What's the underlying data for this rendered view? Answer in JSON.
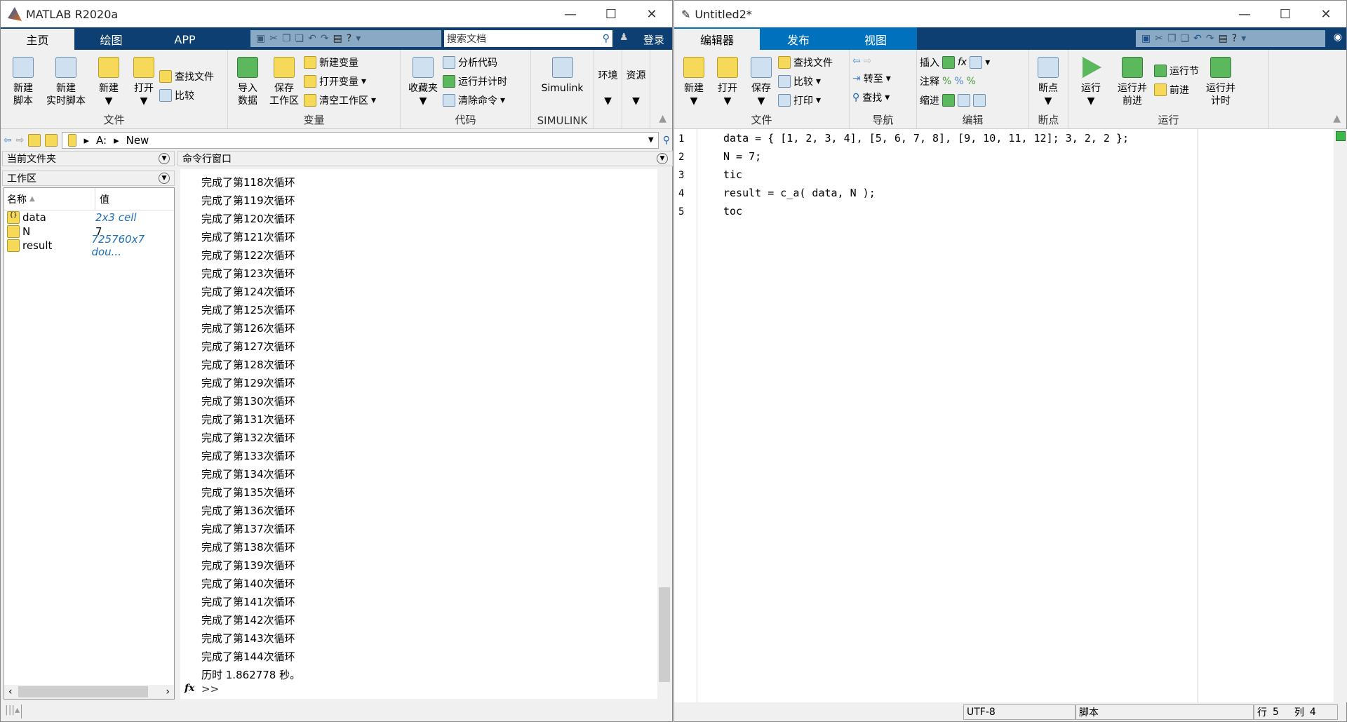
{
  "left": {
    "title": "MATLAB R2020a",
    "tabs": [
      "主页",
      "绘图",
      "APP"
    ],
    "search_placeholder": "搜索文档",
    "login": "登录",
    "groups": {
      "file": {
        "label": "文件",
        "new_script": [
          "新建",
          "脚本"
        ],
        "new_live": [
          "新建",
          "实时脚本"
        ],
        "new": "新建",
        "open": "打开",
        "find_files": "查找文件",
        "compare": "比较"
      },
      "variable": {
        "label": "变量",
        "import": [
          "导入",
          "数据"
        ],
        "save_ws": [
          "保存",
          "工作区"
        ],
        "new_var": "新建变量",
        "open_var": "打开变量",
        "clear_ws": "清空工作区"
      },
      "code": {
        "label": "代码",
        "favorites": "收藏夹",
        "analyze": "分析代码",
        "run_time": "运行并计时",
        "clear_cmd": "清除命令"
      },
      "simulink": {
        "label": "SIMULINK",
        "simulink": "Simulink"
      },
      "env": "环境",
      "resources": "资源"
    },
    "path": [
      "A:",
      "New"
    ],
    "current_folder": "当前文件夹",
    "workspace": {
      "title": "工作区",
      "col_name": "名称",
      "col_value": "值",
      "rows": [
        {
          "name": "data",
          "value": "2x3 cell"
        },
        {
          "name": "N",
          "value": "7"
        },
        {
          "name": "result",
          "value": "725760x7 dou..."
        }
      ]
    },
    "command_window": {
      "title": "命令行窗口",
      "lines": [
        "完成了第118次循环",
        "完成了第119次循环",
        "完成了第120次循环",
        "完成了第121次循环",
        "完成了第122次循环",
        "完成了第123次循环",
        "完成了第124次循环",
        "完成了第125次循环",
        "完成了第126次循环",
        "完成了第127次循环",
        "完成了第128次循环",
        "完成了第129次循环",
        "完成了第130次循环",
        "完成了第131次循环",
        "完成了第132次循环",
        "完成了第133次循环",
        "完成了第134次循环",
        "完成了第135次循环",
        "完成了第136次循环",
        "完成了第137次循环",
        "完成了第138次循环",
        "完成了第139次循环",
        "完成了第140次循环",
        "完成了第141次循环",
        "完成了第142次循环",
        "完成了第143次循环",
        "完成了第144次循环",
        "历时 1.862778 秒。"
      ],
      "prompt": ">>",
      "fx": "fx"
    }
  },
  "right": {
    "title": "Untitled2*",
    "tabs": [
      "编辑器",
      "发布",
      "视图"
    ],
    "groups": {
      "file": {
        "label": "文件",
        "new": "新建",
        "open": "打开",
        "save": "保存",
        "find_files": "查找文件",
        "compare": "比较",
        "print": "打印"
      },
      "nav": {
        "label": "导航",
        "goto": "转至",
        "find": "查找"
      },
      "edit": {
        "label": "编辑",
        "insert": "插入",
        "comment": "注释",
        "indent": "缩进",
        "fx": "fx"
      },
      "breakpoints": {
        "label": "断点",
        "bp": "断点"
      },
      "run": {
        "label": "运行",
        "run": "运行",
        "run_advance": [
          "运行并",
          "前进"
        ],
        "run_section": "运行节",
        "advance": "前进",
        "run_time": [
          "运行并",
          "计时"
        ]
      }
    },
    "code": [
      "data = { [1, 2, 3, 4], [5, 6, 7, 8], [9, 10, 11, 12]; 3, 2, 2 };",
      "N = 7;",
      "tic",
      "result = c_a( data, N );",
      "toc"
    ],
    "status": {
      "encoding": "UTF-8",
      "type": "脚本",
      "row_label": "行",
      "row": "5",
      "col_label": "列",
      "col": "4"
    }
  },
  "colors": {
    "tabbar": "#0d3f72",
    "editor_tabs": "#0072bd",
    "link": "#1f6fb8"
  }
}
